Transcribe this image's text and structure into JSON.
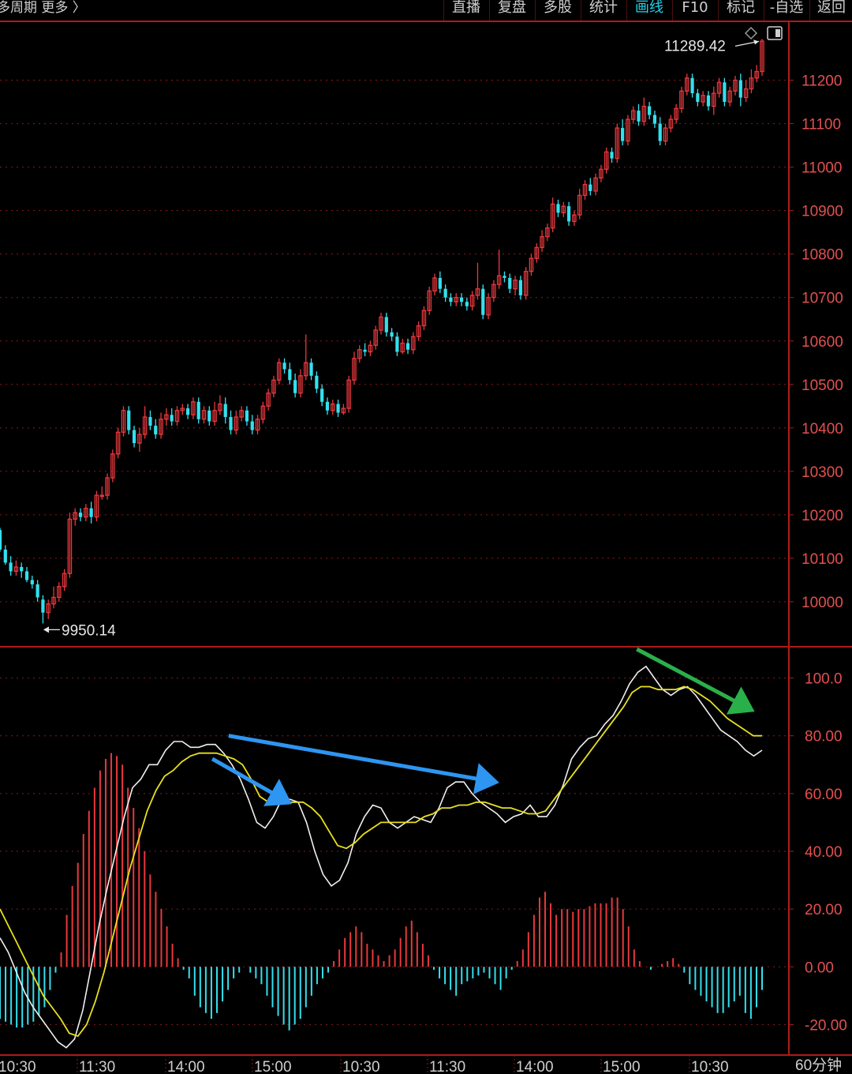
{
  "toolbar": {
    "period_label": "多周期  更多 〉",
    "tabs": [
      "直播",
      "复盘",
      "多股",
      "统计",
      "画线",
      "F10",
      "标记",
      "-自选",
      "返回"
    ],
    "active_tab": "画线"
  },
  "timeframe": "60分钟",
  "colors": {
    "up": "#e8383d",
    "down": "#33e0ee",
    "k_line": "#f0f0f0",
    "d_line": "#e8e020",
    "grid": "#8a1a1a",
    "arrow_blue": "#2e95f0",
    "arrow_green": "#2ab04a"
  },
  "chart_data": [
    {
      "type": "candlestick",
      "ylim": [
        9900,
        11330
      ],
      "y_ticks": [
        "11200",
        "11100",
        "11000",
        "10900",
        "10800",
        "10700",
        "10600",
        "10500",
        "10400",
        "10300",
        "10200",
        "10100",
        "10000"
      ],
      "x_ticks": [
        "10:30",
        "11:30",
        "14:00",
        "15:00",
        "10:30",
        "11:30",
        "14:00",
        "15:00",
        "10:30"
      ],
      "annotations": {
        "high": "11289.42",
        "low": "9950.14"
      },
      "candles": [
        [
          10165,
          10120,
          10170,
          10115
        ],
        [
          10120,
          10090,
          10130,
          10085
        ],
        [
          10090,
          10070,
          10105,
          10060
        ],
        [
          10070,
          10080,
          10095,
          10060
        ],
        [
          10080,
          10070,
          10090,
          10055
        ],
        [
          10070,
          10050,
          10080,
          10045
        ],
        [
          10050,
          10040,
          10060,
          10030
        ],
        [
          10040,
          10010,
          10050,
          10000
        ],
        [
          10005,
          9975,
          10015,
          9950
        ],
        [
          9975,
          9995,
          10005,
          9960
        ],
        [
          9995,
          10010,
          10035,
          9985
        ],
        [
          10010,
          10035,
          10045,
          10000
        ],
        [
          10035,
          10065,
          10075,
          10025
        ],
        [
          10065,
          10190,
          10205,
          10055
        ],
        [
          10190,
          10205,
          10215,
          10175
        ],
        [
          10205,
          10195,
          10215,
          10185
        ],
        [
          10195,
          10215,
          10225,
          10185
        ],
        [
          10215,
          10195,
          10230,
          10180
        ],
        [
          10195,
          10245,
          10255,
          10185
        ],
        [
          10245,
          10245,
          10265,
          10235
        ],
        [
          10245,
          10285,
          10295,
          10235
        ],
        [
          10285,
          10340,
          10350,
          10275
        ],
        [
          10340,
          10390,
          10400,
          10330
        ],
        [
          10390,
          10440,
          10450,
          10380
        ],
        [
          10440,
          10395,
          10450,
          10385
        ],
        [
          10395,
          10365,
          10405,
          10355
        ],
        [
          10365,
          10385,
          10400,
          10345
        ],
        [
          10385,
          10425,
          10450,
          10375
        ],
        [
          10425,
          10405,
          10440,
          10395
        ],
        [
          10405,
          10385,
          10420,
          10375
        ],
        [
          10385,
          10420,
          10435,
          10375
        ],
        [
          10420,
          10430,
          10445,
          10405
        ],
        [
          10430,
          10415,
          10445,
          10405
        ],
        [
          10415,
          10440,
          10450,
          10405
        ],
        [
          10440,
          10445,
          10455,
          10430
        ],
        [
          10445,
          10430,
          10455,
          10420
        ],
        [
          10430,
          10460,
          10470,
          10420
        ],
        [
          10460,
          10420,
          10470,
          10410
        ],
        [
          10420,
          10440,
          10450,
          10410
        ],
        [
          10440,
          10415,
          10450,
          10405
        ],
        [
          10415,
          10440,
          10460,
          10405
        ],
        [
          10440,
          10455,
          10475,
          10430
        ],
        [
          10455,
          10425,
          10470,
          10410
        ],
        [
          10425,
          10395,
          10440,
          10385
        ],
        [
          10395,
          10425,
          10440,
          10385
        ],
        [
          10425,
          10440,
          10450,
          10415
        ],
        [
          10440,
          10415,
          10450,
          10405
        ],
        [
          10415,
          10395,
          10430,
          10385
        ],
        [
          10395,
          10420,
          10430,
          10385
        ],
        [
          10420,
          10450,
          10460,
          10410
        ],
        [
          10450,
          10480,
          10490,
          10440
        ],
        [
          10480,
          10510,
          10520,
          10470
        ],
        [
          10510,
          10550,
          10560,
          10500
        ],
        [
          10550,
          10535,
          10560,
          10525
        ],
        [
          10535,
          10510,
          10550,
          10500
        ],
        [
          10510,
          10480,
          10525,
          10470
        ],
        [
          10480,
          10520,
          10535,
          10470
        ],
        [
          10520,
          10550,
          10615,
          10510
        ],
        [
          10550,
          10520,
          10560,
          10510
        ],
        [
          10520,
          10490,
          10530,
          10480
        ],
        [
          10490,
          10460,
          10500,
          10450
        ],
        [
          10460,
          10440,
          10470,
          10430
        ],
        [
          10440,
          10455,
          10465,
          10430
        ],
        [
          10455,
          10435,
          10465,
          10425
        ],
        [
          10435,
          10445,
          10455,
          10430
        ],
        [
          10445,
          10510,
          10520,
          10435
        ],
        [
          10510,
          10560,
          10575,
          10500
        ],
        [
          10560,
          10580,
          10590,
          10550
        ],
        [
          10580,
          10575,
          10595,
          10565
        ],
        [
          10575,
          10590,
          10600,
          10565
        ],
        [
          10590,
          10625,
          10635,
          10580
        ],
        [
          10625,
          10655,
          10665,
          10615
        ],
        [
          10655,
          10620,
          10665,
          10610
        ],
        [
          10620,
          10610,
          10630,
          10600
        ],
        [
          10610,
          10575,
          10620,
          10565
        ],
        [
          10575,
          10595,
          10605,
          10570
        ],
        [
          10595,
          10580,
          10605,
          10570
        ],
        [
          10580,
          10610,
          10620,
          10570
        ],
        [
          10610,
          10635,
          10645,
          10600
        ],
        [
          10635,
          10670,
          10680,
          10625
        ],
        [
          10670,
          10715,
          10725,
          10660
        ],
        [
          10715,
          10745,
          10755,
          10705
        ],
        [
          10745,
          10720,
          10760,
          10710
        ],
        [
          10720,
          10700,
          10730,
          10690
        ],
        [
          10700,
          10690,
          10710,
          10680
        ],
        [
          10690,
          10700,
          10710,
          10680
        ],
        [
          10700,
          10690,
          10710,
          10680
        ],
        [
          10690,
          10680,
          10700,
          10670
        ],
        [
          10680,
          10705,
          10715,
          10670
        ],
        [
          10705,
          10720,
          10780,
          10695
        ],
        [
          10720,
          10660,
          10730,
          10650
        ],
        [
          10660,
          10700,
          10710,
          10650
        ],
        [
          10700,
          10730,
          10740,
          10690
        ],
        [
          10730,
          10750,
          10810,
          10720
        ],
        [
          10750,
          10745,
          10760,
          10735
        ],
        [
          10745,
          10720,
          10755,
          10710
        ],
        [
          10720,
          10740,
          10750,
          10705
        ],
        [
          10740,
          10705,
          10750,
          10695
        ],
        [
          10705,
          10760,
          10770,
          10695
        ],
        [
          10760,
          10790,
          10800,
          10750
        ],
        [
          10790,
          10815,
          10825,
          10780
        ],
        [
          10815,
          10840,
          10855,
          10805
        ],
        [
          10840,
          10860,
          10870,
          10830
        ],
        [
          10860,
          10915,
          10930,
          10850
        ],
        [
          10915,
          10895,
          10925,
          10885
        ],
        [
          10895,
          10910,
          10920,
          10885
        ],
        [
          10910,
          10875,
          10920,
          10865
        ],
        [
          10875,
          10890,
          10900,
          10865
        ],
        [
          10890,
          10935,
          10950,
          10880
        ],
        [
          10935,
          10960,
          10970,
          10925
        ],
        [
          10960,
          10945,
          10975,
          10935
        ],
        [
          10945,
          10975,
          10985,
          10935
        ],
        [
          10975,
          10995,
          11005,
          10965
        ],
        [
          10995,
          11035,
          11045,
          10985
        ],
        [
          11035,
          11020,
          11045,
          11010
        ],
        [
          11020,
          11090,
          11100,
          11010
        ],
        [
          11090,
          11060,
          11110,
          11050
        ],
        [
          11060,
          11110,
          11120,
          11050
        ],
        [
          11110,
          11130,
          11140,
          11100
        ],
        [
          11130,
          11105,
          11145,
          11095
        ],
        [
          11105,
          11140,
          11160,
          11095
        ],
        [
          11140,
          11120,
          11150,
          11110
        ],
        [
          11120,
          11100,
          11130,
          11090
        ],
        [
          11100,
          11060,
          11115,
          11050
        ],
        [
          11060,
          11090,
          11100,
          11050
        ],
        [
          11090,
          11110,
          11120,
          11080
        ],
        [
          11110,
          11135,
          11145,
          11100
        ],
        [
          11135,
          11175,
          11185,
          11125
        ],
        [
          11175,
          11205,
          11215,
          11165
        ],
        [
          11205,
          11170,
          11215,
          11160
        ],
        [
          11170,
          11150,
          11180,
          11140
        ],
        [
          11150,
          11165,
          11175,
          11140
        ],
        [
          11165,
          11140,
          11175,
          11130
        ],
        [
          11140,
          11170,
          11185,
          11120
        ],
        [
          11170,
          11195,
          11205,
          11160
        ],
        [
          11195,
          11150,
          11205,
          11140
        ],
        [
          11150,
          11175,
          11185,
          11140
        ],
        [
          11175,
          11200,
          11210,
          11165
        ],
        [
          11200,
          11160,
          11215,
          11140
        ],
        [
          11160,
          11180,
          11200,
          11150
        ],
        [
          11180,
          11205,
          11225,
          11170
        ],
        [
          11205,
          11220,
          11235,
          11195
        ],
        [
          11220,
          11290,
          11295,
          11210
        ]
      ]
    },
    {
      "type": "line",
      "indicator": "KDJ",
      "ylim": [
        -30,
        110
      ],
      "y_ticks": [
        "100.0",
        "80.00",
        "60.00",
        "40.00",
        "20.00",
        "0.00",
        "-20.00"
      ],
      "series": [
        {
          "values": [
            10,
            5,
            -2,
            -9,
            -14,
            -18,
            -22,
            -26,
            -28,
            -25,
            -15,
            0,
            15,
            28,
            40,
            52,
            62,
            65,
            70,
            70,
            75,
            78,
            78,
            76,
            76,
            77,
            77,
            74,
            70,
            65,
            58,
            50,
            48,
            52,
            58,
            58,
            57,
            50,
            40,
            32,
            28,
            30,
            36,
            46,
            52,
            56,
            55,
            50,
            48,
            50,
            52,
            51,
            50,
            55,
            62,
            64,
            64,
            60,
            57,
            55,
            53,
            50,
            52,
            53,
            56,
            52,
            52,
            56,
            63,
            72,
            76,
            79,
            80,
            84,
            87,
            92,
            98,
            102,
            104,
            100,
            96,
            94,
            96,
            97,
            94,
            90,
            86,
            82,
            80,
            78,
            75,
            73,
            75
          ]
        },
        {
          "values": [
            20,
            14,
            8,
            2,
            -4,
            -10,
            -14,
            -18,
            -23,
            -24,
            -20,
            -12,
            -2,
            10,
            22,
            34,
            44,
            54,
            61,
            66,
            68,
            71,
            73,
            74,
            74,
            74,
            73,
            72,
            70,
            65,
            59,
            57,
            57,
            57,
            57,
            57,
            55,
            52,
            47,
            42,
            41,
            43,
            46,
            48,
            50,
            50,
            50,
            50,
            50,
            52,
            53,
            55,
            55,
            56,
            56,
            57,
            57,
            56,
            55,
            55,
            54,
            53,
            53,
            54,
            58,
            62,
            66,
            70,
            74,
            78,
            82,
            86,
            90,
            95,
            97,
            97,
            96,
            96,
            96,
            97,
            96,
            94,
            92,
            89,
            86,
            84,
            82,
            80,
            80
          ]
        }
      ],
      "macd_bars": [
        -18,
        -19,
        -20,
        -21,
        -21,
        -20,
        -19,
        -17,
        -14,
        -8,
        -2,
        5,
        18,
        28,
        36,
        46,
        54,
        62,
        68,
        72,
        74,
        73,
        70,
        62,
        55,
        48,
        40,
        32,
        26,
        20,
        14,
        8,
        3,
        -1,
        -4,
        -10,
        -14,
        -16,
        -18,
        -16,
        -12,
        -8,
        -4,
        -2,
        0,
        -2,
        -4,
        -6,
        -10,
        -14,
        -17,
        -20,
        -22,
        -20,
        -18,
        -14,
        -10,
        -6,
        -4,
        -2,
        2,
        6,
        10,
        12,
        14,
        12,
        8,
        6,
        4,
        2,
        4,
        6,
        10,
        14,
        16,
        12,
        8,
        4,
        -1,
        -4,
        -6,
        -8,
        -10,
        -6,
        -5,
        -4,
        -3,
        -2,
        -4,
        -6,
        -8,
        -4,
        -1,
        2,
        6,
        12,
        18,
        24,
        26,
        22,
        18,
        20,
        20,
        19,
        20,
        20,
        21,
        22,
        22,
        22,
        24,
        24,
        20,
        14,
        6,
        2,
        0,
        -1,
        0,
        1,
        2,
        3,
        1,
        -2,
        -6,
        -8,
        -10,
        -12,
        -14,
        -16,
        -16,
        -14,
        -12,
        -10,
        -16,
        -18,
        -14,
        -8
      ]
    }
  ]
}
